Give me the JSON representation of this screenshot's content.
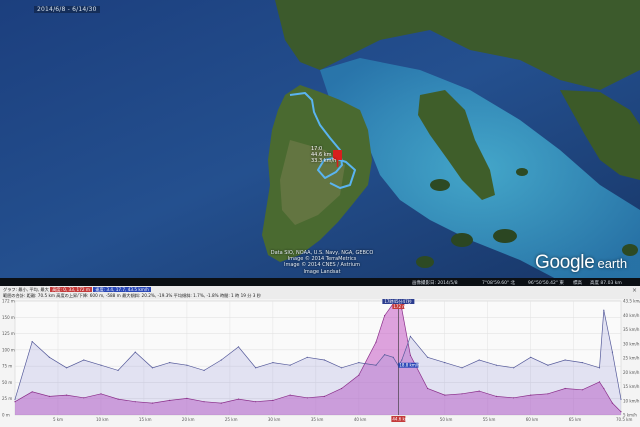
{
  "map": {
    "date_label": "2014/6/8 - 6/14/30",
    "pin_labels": [
      "17:0",
      "44.6 km",
      "33.3 km/h"
    ],
    "attribution": [
      "Data SIO, NOAA, U.S. Navy, NGA, GEBCO",
      "Image © 2014 TerraMetrics",
      "Image © 2014 CNES / Astrium",
      "Image Landsat"
    ],
    "logo_word1": "Google",
    "logo_word2": "earth",
    "colors": {
      "ocean_deep": "#1b3c78",
      "ocean_mid": "#2656a0",
      "shallow": "#3aa0c8",
      "land": "#3e5a2e",
      "track": "#5ab4f0",
      "pin": "#d81e1e"
    }
  },
  "statusbar": {
    "imagery_date": "画像撮影日: 2014/5/8",
    "lat": "7°08'59.60\" 北",
    "lon": "96°50'50.42\" 東",
    "elev": "標高",
    "eye": "高度 87.03 km"
  },
  "profile_header": {
    "row1_prefix": "グラフ: 最小, 平均, 最大",
    "row1_elevation": "高度: 0, 33, 172 m",
    "row1_speed": "速度: 3.4, 17.7, 43.5 km/h",
    "row2": "範囲の合計: 距離: 70.5 km  高度の上昇/下降: 600 m, -588 m  最大傾斜: 20.2%, -19.3%  平均傾斜: 1.7%, -1.8%  時間: 1 時 19 分 3 秒",
    "close_label": "×"
  },
  "chart_data": {
    "type": "area",
    "title": "",
    "xlabel": "",
    "ylabel": "",
    "x": [
      0,
      2,
      4,
      6,
      8,
      10,
      12,
      14,
      16,
      18,
      20,
      22,
      24,
      26,
      28,
      30,
      32,
      34,
      36,
      38,
      40,
      42,
      43,
      44,
      44.6,
      45,
      46,
      48,
      50,
      52,
      54,
      56,
      58,
      60,
      62,
      64,
      66,
      68,
      68.5,
      69.5,
      70.5
    ],
    "x_ticks": [
      "5 km",
      "10 km",
      "15 km",
      "20 km",
      "25 km",
      "30 km",
      "35 km",
      "40 km",
      "44.6 km",
      "50 km",
      "55 km",
      "60 km",
      "65 km",
      "70.5 km"
    ],
    "xlim": [
      0,
      70.5
    ],
    "left_axis_ticks": [
      "172 m",
      "150 m",
      "125 m",
      "100 m",
      "75 m",
      "50 m",
      "25 m",
      "0 m"
    ],
    "right_axis_ticks": [
      "43.5 km/h",
      "40 km/h",
      "35 km/h",
      "30 km/h",
      "25 km/h",
      "20 km/h",
      "15 km/h",
      "10 km/h",
      "5 km/h"
    ],
    "series": [
      {
        "name": "高度",
        "unit": "m",
        "ylim": [
          0,
          172
        ],
        "color": "#c45ac4",
        "values": [
          20,
          35,
          28,
          30,
          26,
          32,
          24,
          20,
          18,
          22,
          25,
          20,
          18,
          24,
          20,
          22,
          30,
          26,
          28,
          40,
          60,
          110,
          150,
          168,
          172,
          160,
          90,
          40,
          30,
          32,
          36,
          28,
          26,
          30,
          32,
          40,
          38,
          50,
          40,
          18,
          5
        ]
      },
      {
        "name": "速度",
        "unit": "km/h",
        "ylim": [
          0,
          43.5
        ],
        "color": "#8b8fd8",
        "values": [
          6,
          28,
          22,
          18,
          21,
          19,
          17,
          24,
          18,
          20,
          19,
          17,
          21,
          26,
          18,
          20,
          19,
          22,
          21,
          18,
          20,
          19,
          23,
          22,
          18.8,
          21,
          30,
          22,
          20,
          18,
          21,
          19,
          18,
          22,
          19,
          21,
          20,
          18,
          40,
          24,
          6
        ]
      }
    ],
    "cursor": {
      "distance_label": "44.6 km",
      "top_label": "17時45分47秒",
      "elevation_label": "172 m",
      "speed_label": "18.8 km/h",
      "bottom_label": "44.6 km"
    },
    "grid": true
  }
}
